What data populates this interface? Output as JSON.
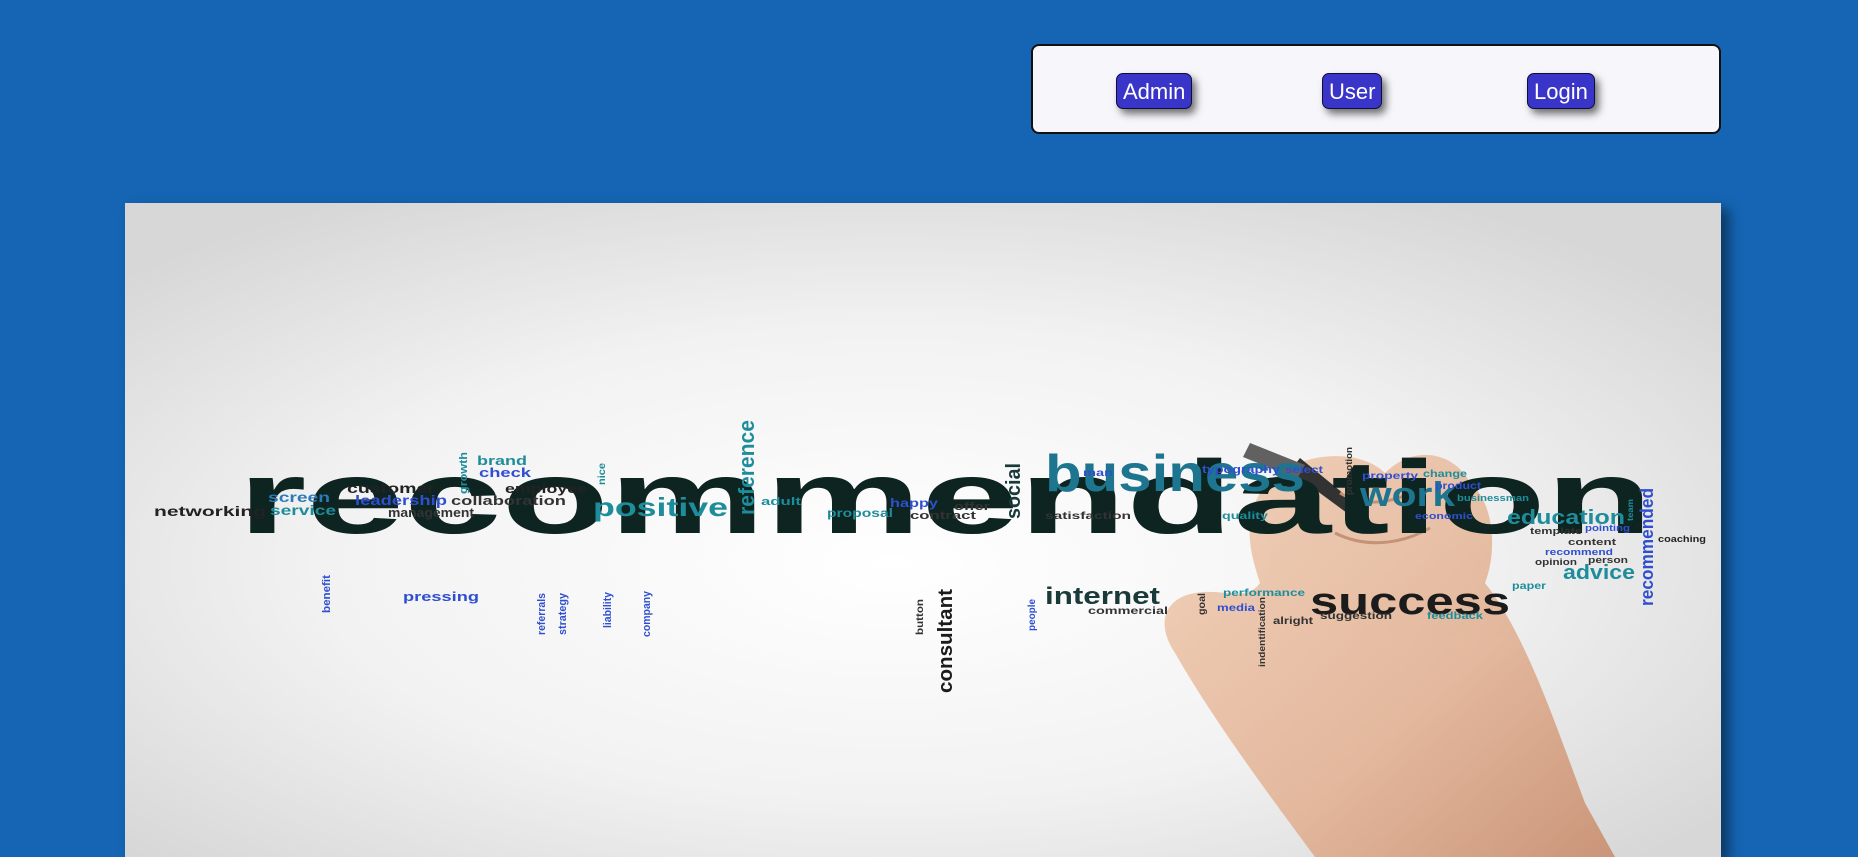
{
  "nav": {
    "admin_label": "Admin",
    "user_label": "User",
    "login_label": "Login"
  },
  "hero": {
    "main_word": "recommendation",
    "words": [
      {
        "id": "business",
        "text": "business"
      },
      {
        "id": "success",
        "text": "success"
      },
      {
        "id": "work",
        "text": "work"
      },
      {
        "id": "positive",
        "text": "positive"
      },
      {
        "id": "reference",
        "text": "reference"
      },
      {
        "id": "internet",
        "text": "internet"
      },
      {
        "id": "consultant",
        "text": "consultant"
      },
      {
        "id": "education",
        "text": "education"
      },
      {
        "id": "advice",
        "text": "advice"
      },
      {
        "id": "recommended",
        "text": "recommended"
      },
      {
        "id": "social",
        "text": "social"
      },
      {
        "id": "networking",
        "text": "networking"
      },
      {
        "id": "screen",
        "text": "screen"
      },
      {
        "id": "service",
        "text": "service"
      },
      {
        "id": "customer",
        "text": "customer"
      },
      {
        "id": "leadership",
        "text": "leadership"
      },
      {
        "id": "management",
        "text": "management"
      },
      {
        "id": "growth",
        "text": "growth"
      },
      {
        "id": "brand",
        "text": "brand"
      },
      {
        "id": "check",
        "text": "check"
      },
      {
        "id": "employee",
        "text": "employee"
      },
      {
        "id": "collaboration",
        "text": "collaboration"
      },
      {
        "id": "nice",
        "text": "nice"
      },
      {
        "id": "adult",
        "text": "adult"
      },
      {
        "id": "proposal",
        "text": "proposal"
      },
      {
        "id": "happy",
        "text": "happy"
      },
      {
        "id": "offer",
        "text": "offer"
      },
      {
        "id": "contract",
        "text": "contract"
      },
      {
        "id": "satisfaction",
        "text": "satisfaction"
      },
      {
        "id": "man",
        "text": "man"
      },
      {
        "id": "typography",
        "text": "typography"
      },
      {
        "id": "select",
        "text": "select"
      },
      {
        "id": "promotion",
        "text": "promotion"
      },
      {
        "id": "property",
        "text": "property"
      },
      {
        "id": "change",
        "text": "change"
      },
      {
        "id": "product",
        "text": "product"
      },
      {
        "id": "businessman",
        "text": "businessman"
      },
      {
        "id": "quality",
        "text": "quality"
      },
      {
        "id": "economic",
        "text": "economic"
      },
      {
        "id": "team",
        "text": "team"
      },
      {
        "id": "template",
        "text": "template"
      },
      {
        "id": "pointing",
        "text": "pointing"
      },
      {
        "id": "content",
        "text": "content"
      },
      {
        "id": "recommend",
        "text": "recommend"
      },
      {
        "id": "opinion",
        "text": "opinion"
      },
      {
        "id": "person",
        "text": "person"
      },
      {
        "id": "coaching",
        "text": "coaching"
      },
      {
        "id": "paper",
        "text": "paper"
      },
      {
        "id": "performance",
        "text": "performance"
      },
      {
        "id": "goal",
        "text": "goal"
      },
      {
        "id": "media",
        "text": "media"
      },
      {
        "id": "commercial",
        "text": "commercial"
      },
      {
        "id": "alright",
        "text": "alright"
      },
      {
        "id": "suggestion",
        "text": "suggestion"
      },
      {
        "id": "feedback",
        "text": "feedback"
      },
      {
        "id": "people",
        "text": "people"
      },
      {
        "id": "button",
        "text": "button"
      },
      {
        "id": "indentification",
        "text": "indentification"
      },
      {
        "id": "benefit",
        "text": "benefit"
      },
      {
        "id": "pressing",
        "text": "pressing"
      },
      {
        "id": "referrals",
        "text": "referrals"
      },
      {
        "id": "strategy",
        "text": "strategy"
      },
      {
        "id": "liability",
        "text": "liability"
      },
      {
        "id": "company",
        "text": "company"
      }
    ]
  },
  "colors": {
    "page_background": "#1565b4",
    "button_background": "#3a35c9",
    "panel_background": "#f7f7fb"
  }
}
